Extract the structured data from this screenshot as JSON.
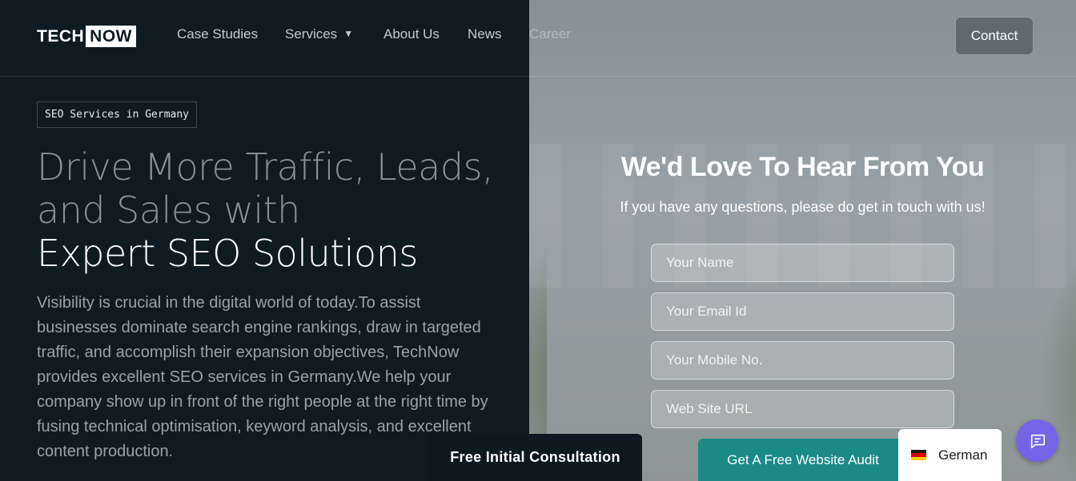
{
  "header": {
    "logo": {
      "part1": "TECH",
      "part2": "NOW"
    },
    "nav": [
      {
        "label": "Case Studies"
      },
      {
        "label": "Services"
      },
      {
        "label": "About Us"
      },
      {
        "label": "News"
      },
      {
        "label": "Career"
      }
    ],
    "contact_label": "Contact"
  },
  "hero": {
    "tag": "SEO Services in Germany",
    "headline_line1": "Drive More Traffic, Leads,",
    "headline_line2": "and Sales with",
    "headline_line3": "Expert SEO Solutions",
    "body": "Visibility is crucial in the digital world of today.To assist businesses dominate search engine rankings, draw in targeted traffic, and accomplish their expansion objectives, TechNow provides excellent SEO services in Germany.We help your company show up in front of the right people at the right time by fusing technical optimisation, keyword analysis, and excellent content production."
  },
  "form": {
    "title": "We'd Love To Hear From You",
    "subtitle": "If you have any questions, please do get in touch with us!",
    "name_placeholder": "Your Name",
    "email_placeholder": "Your Email Id",
    "mobile_placeholder": "Your Mobile No.",
    "website_placeholder": "Web Site URL"
  },
  "bottom_bar": {
    "consultation_label": "Free Initial Consultation",
    "audit_label": "Get A Free Website Audit",
    "language_label": "German"
  },
  "colors": {
    "background": "#0e1c22",
    "audit_button": "#1a8a87",
    "chat_button": "#7664e8"
  },
  "icons": {
    "services_chevron": "chevron-down-icon",
    "language_flag": "germany-flag-icon",
    "chat": "chat-bubble-icon"
  }
}
